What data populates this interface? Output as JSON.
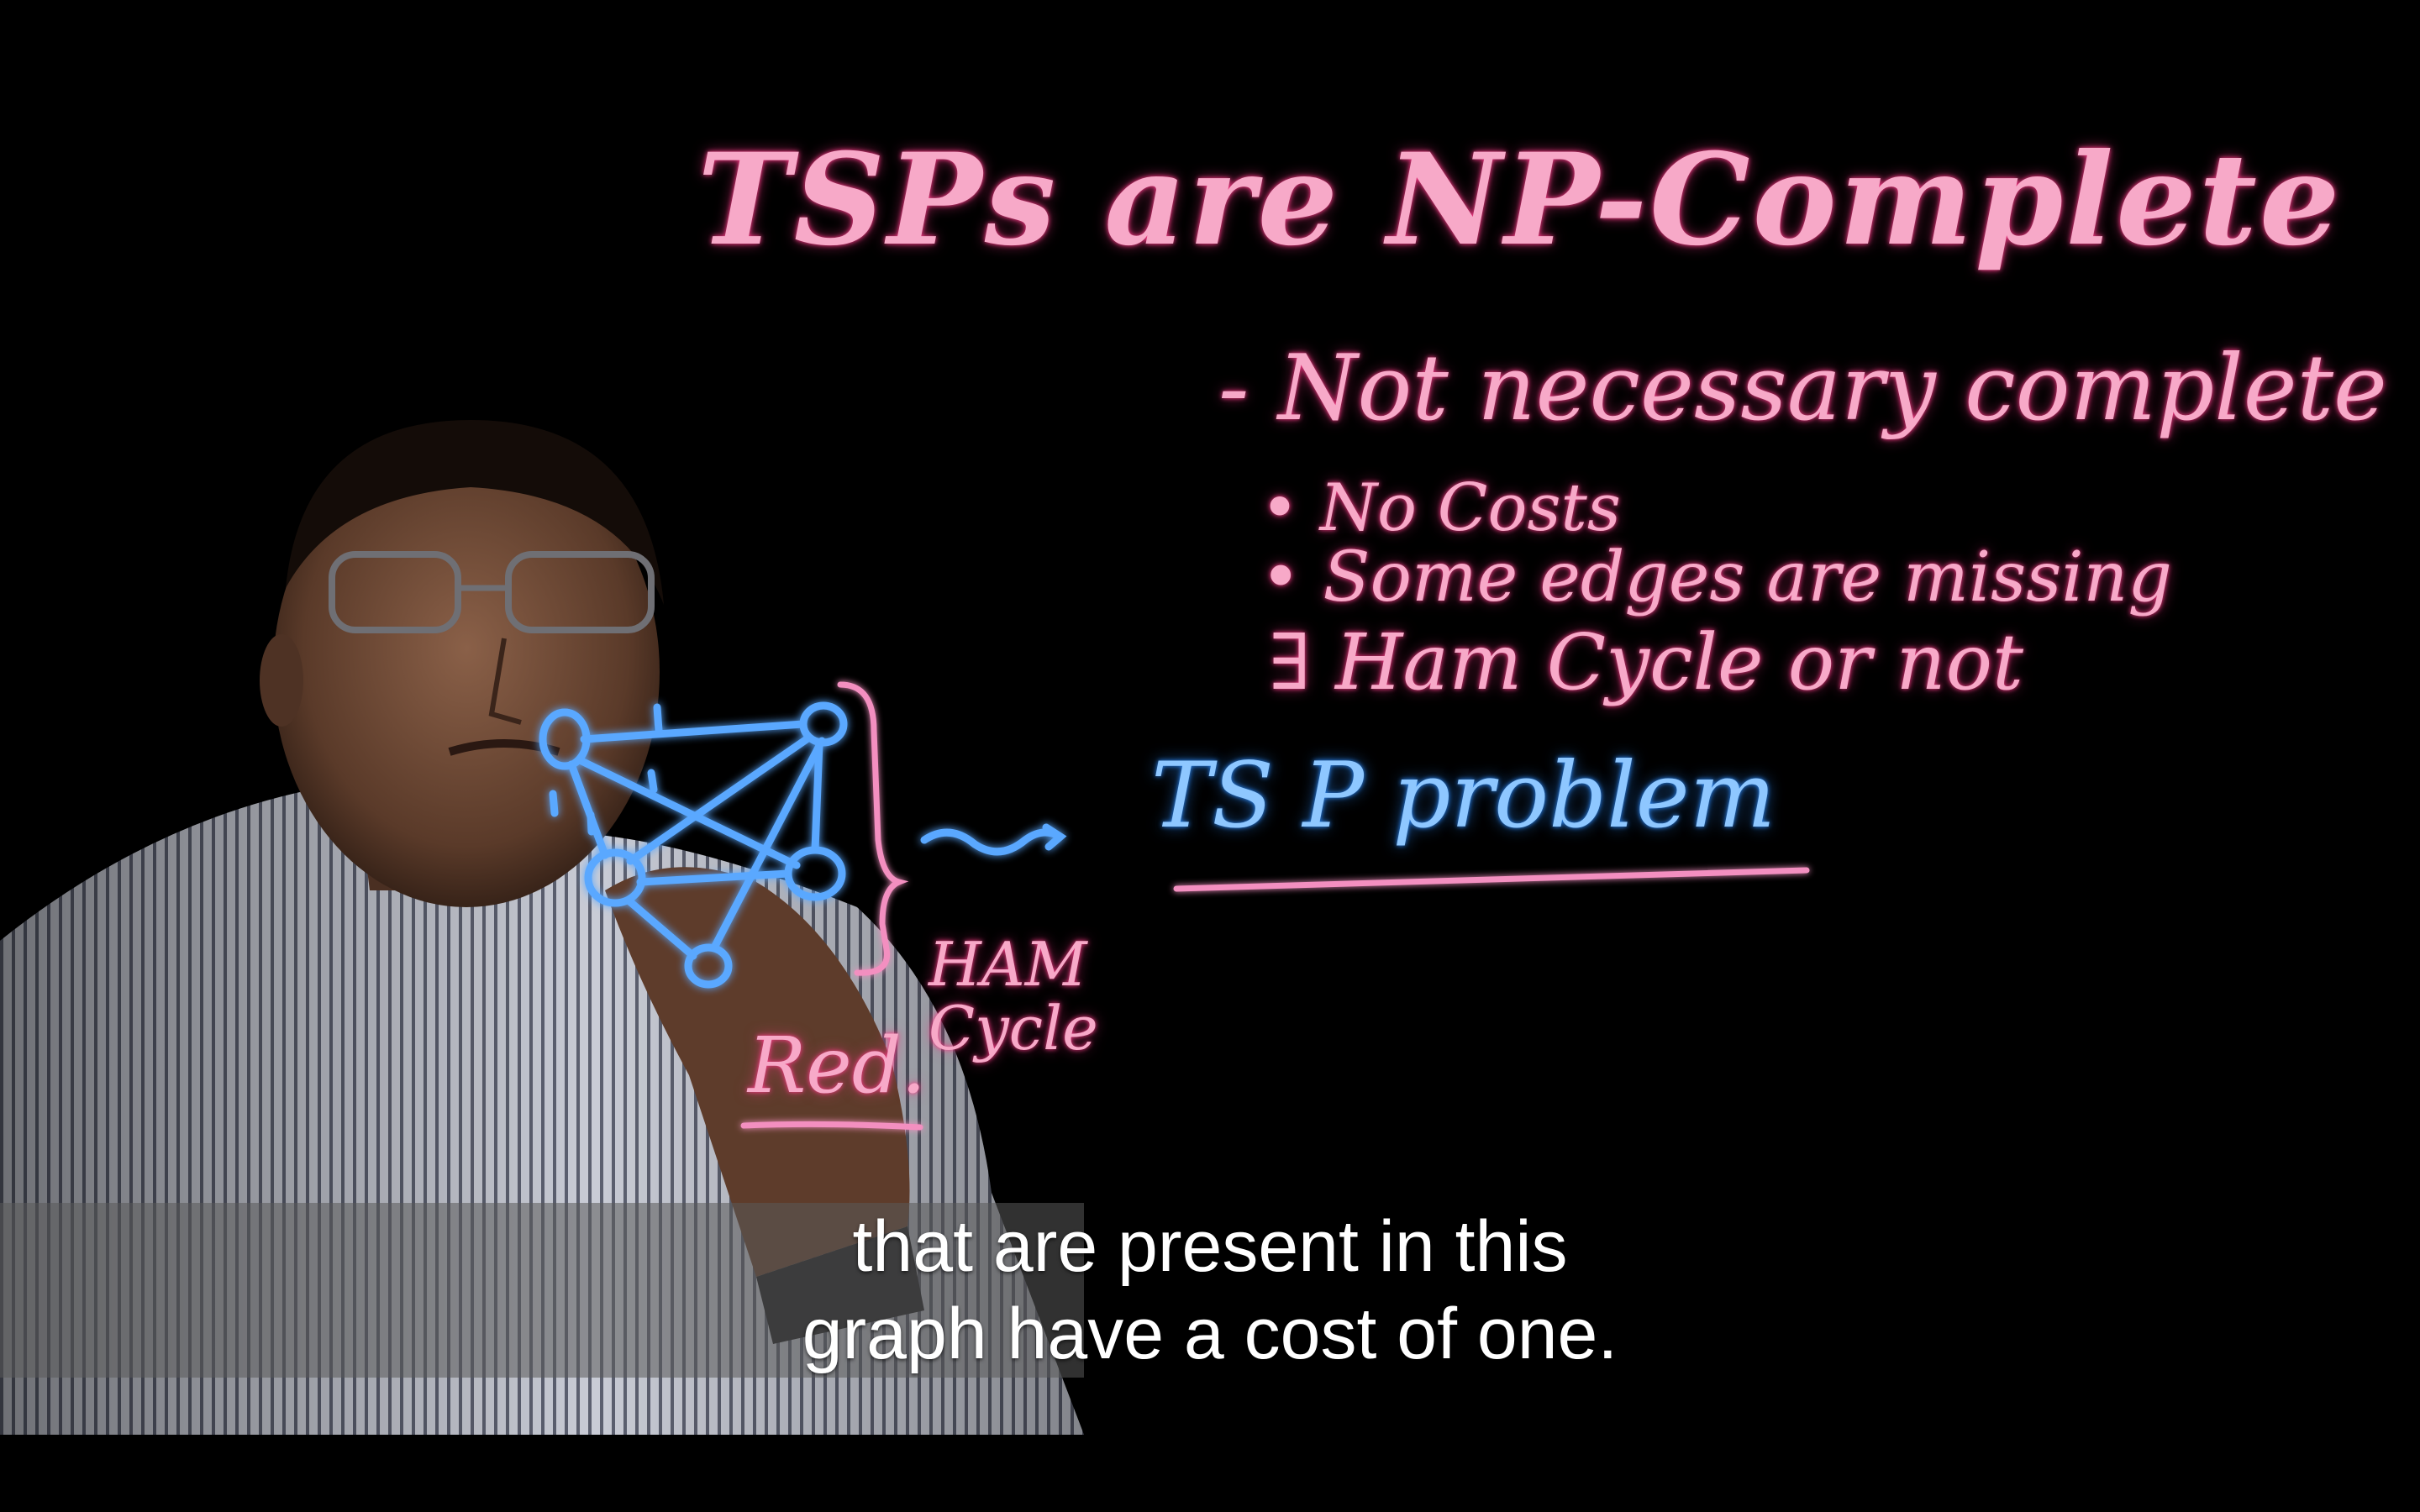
{
  "window": {
    "title": ""
  },
  "board": {
    "title": "TSPs are NP-Complete",
    "bullet1": "- Not necessary complete",
    "bullet2a": "• No Costs",
    "bullet2b": "• Some edges are missing",
    "bullet3": "∃ Ham Cycle or not",
    "tsp": "TS P problem",
    "ham": "HAM\nCycle",
    "red": "Red."
  },
  "captions": {
    "line1": "that are present in this",
    "line2": "graph have a cost of one."
  },
  "colors": {
    "ink_pink": "#f7a9c8",
    "ink_blue": "#8ec7ff",
    "background": "#000000",
    "caption_text": "#ffffff"
  }
}
